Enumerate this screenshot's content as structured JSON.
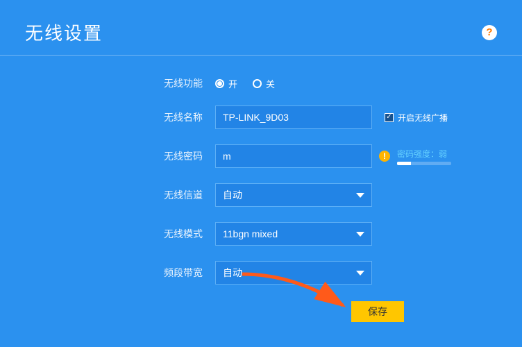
{
  "header": {
    "title": "无线设置"
  },
  "labels": {
    "wireless_function": "无线功能",
    "ssid": "无线名称",
    "password": "无线密码",
    "channel": "无线信道",
    "mode": "无线模式",
    "bandwidth": "频段带宽"
  },
  "radio": {
    "on_label": "开",
    "off_label": "关",
    "selected": "开"
  },
  "ssid": {
    "value": "TP-LINK_9D03"
  },
  "broadcast": {
    "checked": true,
    "label": "开启无线广播"
  },
  "password": {
    "value": "m"
  },
  "strength": {
    "label": "密码强度：弱"
  },
  "channel": {
    "value": "自动"
  },
  "mode": {
    "value": "11bgn mixed"
  },
  "bandwidth": {
    "value": "自动"
  },
  "buttons": {
    "save": "保存"
  }
}
